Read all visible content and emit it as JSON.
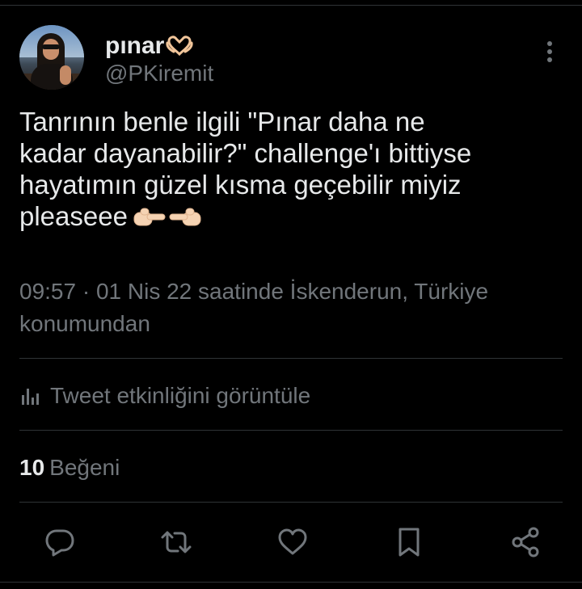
{
  "author": {
    "display_name": "pınar",
    "name_emoji": "heart-hands-icon",
    "handle": "@PKiremit"
  },
  "tweet": {
    "text": "Tanrının benle ilgili \"Pınar daha ne\nkadar dayanabilir?\" challenge'ı bittiyse\nhayatımın güzel kısma geçebilir miyiz\npleaseee",
    "trailing_emoji": "pointing-hands-icon"
  },
  "meta": {
    "time": "09:57",
    "separator": " · ",
    "date_location": "01 Nis 22 saatinde İskenderun, Türkiye konumundan"
  },
  "activity": {
    "label": "Tweet etkinliğini görüntüle",
    "icon": "analytics-icon"
  },
  "likes": {
    "count": "10",
    "label": "Beğeni"
  },
  "actions": [
    {
      "name": "reply",
      "icon": "reply-icon"
    },
    {
      "name": "retweet",
      "icon": "retweet-icon"
    },
    {
      "name": "like",
      "icon": "heart-icon"
    },
    {
      "name": "bookmark",
      "icon": "bookmark-icon"
    },
    {
      "name": "share",
      "icon": "share-icon"
    }
  ],
  "colors": {
    "background": "#000000",
    "text_primary": "#e7e9ea",
    "text_secondary": "#71767b",
    "divider": "#2f3336"
  }
}
